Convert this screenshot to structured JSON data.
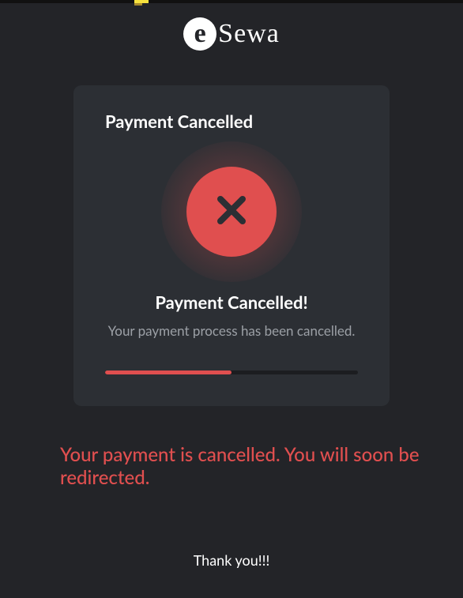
{
  "brand": {
    "mark_letter": "e",
    "name": "Sewa"
  },
  "card": {
    "heading": "Payment Cancelled",
    "icon": "x-cross-icon",
    "status_title": "Payment Cancelled!",
    "status_subtitle": "Your payment process has been cancelled.",
    "progress_percent": 50
  },
  "redirect_message": "Your payment is cancelled. You will soon be redirected.",
  "footer_message": "Thank you!!!",
  "colors": {
    "background": "#232428",
    "card_bg": "#2c2f34",
    "accent_error": "#e04f4f",
    "text_primary": "#ffffff",
    "text_muted": "#9ca0a6"
  }
}
